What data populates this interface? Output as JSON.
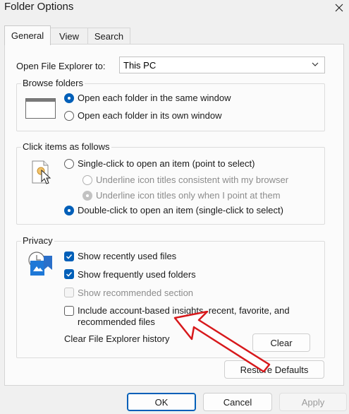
{
  "window": {
    "title": "Folder Options"
  },
  "tabs": [
    {
      "label": "General",
      "active": true
    },
    {
      "label": "View",
      "active": false
    },
    {
      "label": "Search",
      "active": false
    }
  ],
  "open_file_explorer": {
    "label": "Open File Explorer to:",
    "value": "This PC"
  },
  "browse_folders": {
    "label": "Browse folders",
    "options": [
      {
        "label": "Open each folder in the same window",
        "selected": true
      },
      {
        "label": "Open each folder in its own window",
        "selected": false
      }
    ]
  },
  "click_items": {
    "label": "Click items as follows",
    "single_click": {
      "label": "Single-click to open an item (point to select)",
      "selected": false
    },
    "sub_options": [
      {
        "label": "Underline icon titles consistent with my browser",
        "selected": false,
        "enabled": false
      },
      {
        "label": "Underline icon titles only when I point at them",
        "selected": true,
        "enabled": false
      }
    ],
    "double_click": {
      "label": "Double-click to open an item (single-click to select)",
      "selected": true
    }
  },
  "privacy": {
    "label": "Privacy",
    "items": [
      {
        "label": "Show recently used files",
        "checked": true,
        "enabled": true
      },
      {
        "label": "Show frequently used folders",
        "checked": true,
        "enabled": true
      },
      {
        "label": "Show recommended section",
        "checked": false,
        "enabled": false
      },
      {
        "label_line1": "Include account-based insights, recent, favorite, and",
        "label_line2": "recommended files",
        "checked": false,
        "enabled": true
      }
    ],
    "clear_history_label": "Clear File Explorer history",
    "clear_button": "Clear"
  },
  "restore_defaults_button": "Restore Defaults",
  "footer": {
    "ok": "OK",
    "cancel": "Cancel",
    "apply": "Apply"
  },
  "colors": {
    "accent": "#005fb8",
    "annotation_arrow": "#d7191c"
  }
}
